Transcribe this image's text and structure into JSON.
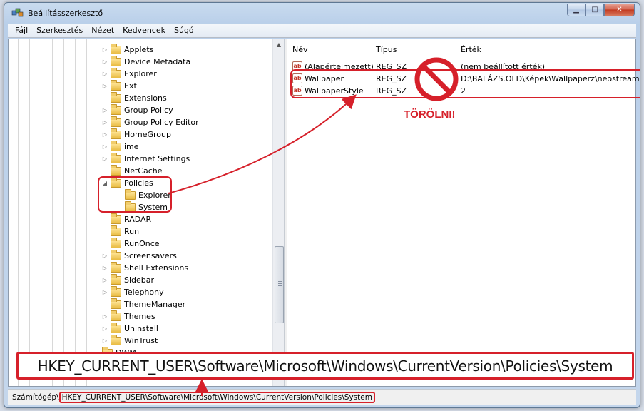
{
  "window": {
    "title": "Beállításszerkesztő"
  },
  "menu": [
    "Fájl",
    "Szerkesztés",
    "Nézet",
    "Kedvencek",
    "Súgó"
  ],
  "tree": [
    {
      "label": "Applets",
      "expander": "▷"
    },
    {
      "label": "Device Metadata",
      "expander": "▷"
    },
    {
      "label": "Explorer",
      "expander": "▷"
    },
    {
      "label": "Ext",
      "expander": "▷"
    },
    {
      "label": "Extensions",
      "expander": ""
    },
    {
      "label": "Group Policy",
      "expander": "▷"
    },
    {
      "label": "Group Policy Editor",
      "expander": "▷"
    },
    {
      "label": "HomeGroup",
      "expander": "▷"
    },
    {
      "label": "ime",
      "expander": "▷"
    },
    {
      "label": "Internet Settings",
      "expander": "▷"
    },
    {
      "label": "NetCache",
      "expander": ""
    },
    {
      "label": "Policies",
      "expander": "◢"
    },
    {
      "label": "Explorer",
      "expander": ""
    },
    {
      "label": "System",
      "expander": ""
    },
    {
      "label": "RADAR",
      "expander": ""
    },
    {
      "label": "Run",
      "expander": ""
    },
    {
      "label": "RunOnce",
      "expander": ""
    },
    {
      "label": "Screensavers",
      "expander": "▷"
    },
    {
      "label": "Shell Extensions",
      "expander": "▷"
    },
    {
      "label": "Sidebar",
      "expander": "▷"
    },
    {
      "label": "Telephony",
      "expander": "▷"
    },
    {
      "label": "ThemeManager",
      "expander": ""
    },
    {
      "label": "Themes",
      "expander": "▷"
    },
    {
      "label": "Uninstall",
      "expander": "▷"
    },
    {
      "label": "WinTrust",
      "expander": "▷"
    },
    {
      "label": "DWM",
      "expander": ""
    }
  ],
  "selected_key": "System",
  "list": {
    "headers": {
      "name": "Név",
      "type": "Típus",
      "data": "Érték"
    },
    "rows": [
      {
        "name": "(Alapértelmezett)",
        "type": "REG_SZ",
        "data": "(nem beállított érték)",
        "icon": "ab"
      },
      {
        "name": "Wallpaper",
        "type": "REG_SZ",
        "data": "D:\\BALÁZS.OLD\\Képek\\Wallpaperz\\neostream.jpg",
        "icon": "ab"
      },
      {
        "name": "WallpaperStyle",
        "type": "REG_SZ",
        "data": "2",
        "icon": "ab"
      }
    ]
  },
  "annotation": {
    "delete_label": "TÖRÖLNI!"
  },
  "callout_path": "HKEY_CURRENT_USER\\Software\\Microsoft\\Windows\\CurrentVersion\\Policies\\System",
  "statusbar": {
    "prefix": "Számítógép\\",
    "path": "HKEY_CURRENT_USER\\Software\\Microsoft\\Windows\\CurrentVersion\\Policies\\System"
  },
  "colors": {
    "annotation_red": "#d6202a",
    "folder": "#e9bc43"
  },
  "icons": [
    "regedit-icon",
    "folder-icon",
    "string-value-icon",
    "no-sign-icon",
    "minimize-icon",
    "maximize-icon",
    "close-icon"
  ]
}
